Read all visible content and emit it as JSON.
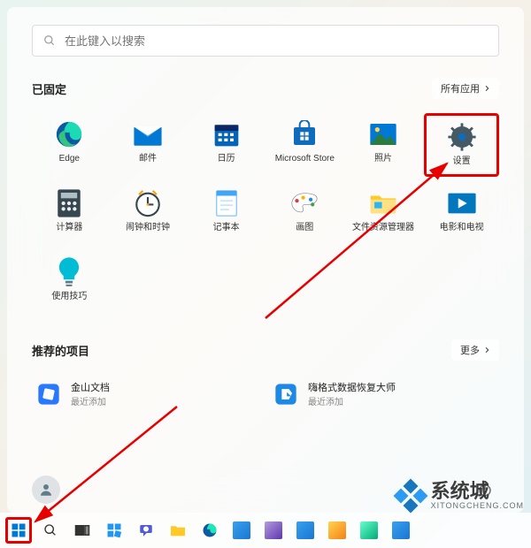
{
  "search": {
    "placeholder": "在此键入以搜索"
  },
  "pinned": {
    "header": "已固定",
    "button": "所有应用",
    "apps": [
      {
        "id": "edge",
        "label": "Edge"
      },
      {
        "id": "mail",
        "label": "邮件"
      },
      {
        "id": "calendar",
        "label": "日历"
      },
      {
        "id": "store",
        "label": "Microsoft Store"
      },
      {
        "id": "photos",
        "label": "照片"
      },
      {
        "id": "settings",
        "label": "设置"
      },
      {
        "id": "calculator",
        "label": "计算器"
      },
      {
        "id": "clock",
        "label": "闹钟和时钟"
      },
      {
        "id": "notepad",
        "label": "记事本"
      },
      {
        "id": "paint",
        "label": "画图"
      },
      {
        "id": "explorer",
        "label": "文件资源管理器"
      },
      {
        "id": "movies",
        "label": "电影和电视"
      },
      {
        "id": "tips",
        "label": "使用技巧"
      }
    ]
  },
  "recommended": {
    "header": "推荐的项目",
    "button": "更多",
    "items": [
      {
        "id": "kingsoft",
        "title": "金山文档",
        "subtitle": "最近添加"
      },
      {
        "id": "datarecovery",
        "title": "嗨格式数据恢复大师",
        "subtitle": "最近添加"
      }
    ]
  },
  "watermark": {
    "text": "系统城",
    "sub": "XITONGCHENG.COM"
  },
  "highlights": {
    "settings_highlighted": true,
    "start_highlighted": true
  }
}
